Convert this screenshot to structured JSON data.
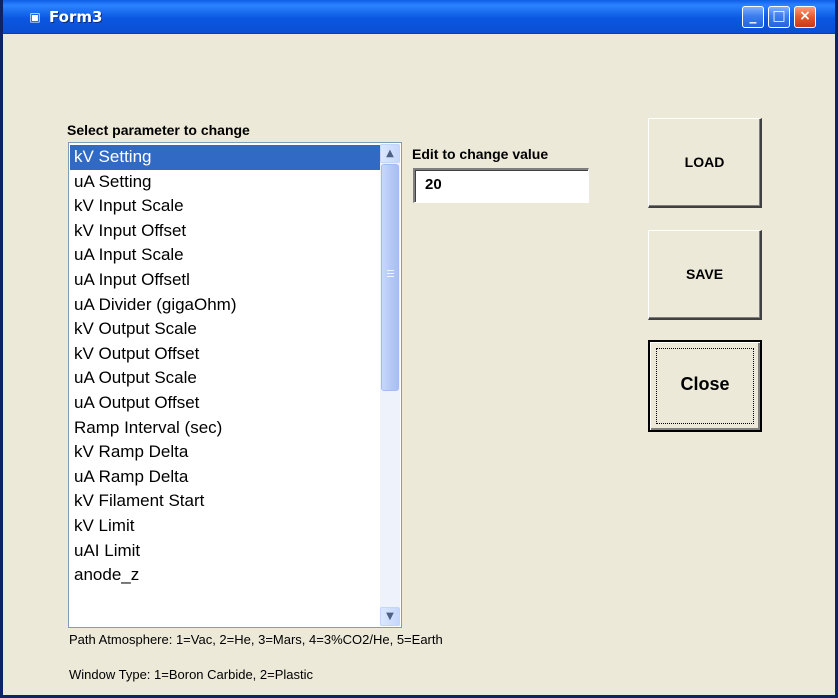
{
  "window": {
    "title": "Form3",
    "icon": "form-window-icon",
    "controls": {
      "minimize": "_",
      "maximize": "□",
      "close": "×"
    }
  },
  "parameters": {
    "label": "Select parameter to change",
    "items": [
      "kV Setting",
      "uA Setting",
      "kV Input Scale",
      "kV Input Offset",
      "uA Input Scale",
      "uA Input Offsetl",
      "uA Divider (gigaOhm)",
      "kV Output Scale",
      "kV Output Offset",
      "uA Output Scale",
      "uA Output Offset",
      "Ramp Interval (sec)",
      "kV Ramp Delta",
      "uA Ramp Delta",
      "kV Filament Start",
      "kV Limit",
      "uAI Limit",
      "anode_z"
    ],
    "selected": "kV Setting"
  },
  "editor": {
    "label": "Edit to change  value",
    "value": "20"
  },
  "buttons": {
    "load": "LOAD",
    "save": "SAVE",
    "close": "Close"
  },
  "scrollbar": {
    "up_arrow": "▲",
    "down_arrow": "▼",
    "icon_up": "scroll-up-arrow-icon",
    "icon_down": "scroll-down-arrow-icon"
  },
  "footer": {
    "path_atmosphere": "Path Atmosphere: 1=Vac, 2=He, 3=Mars, 4=3%CO2/He, 5=Earth",
    "window_type": "Window Type: 1=Boron Carbide, 2=Plastic"
  },
  "colors": {
    "titlebar": "#0b58e0",
    "selection": "#316ac5",
    "form_background": "#ece9d8"
  }
}
